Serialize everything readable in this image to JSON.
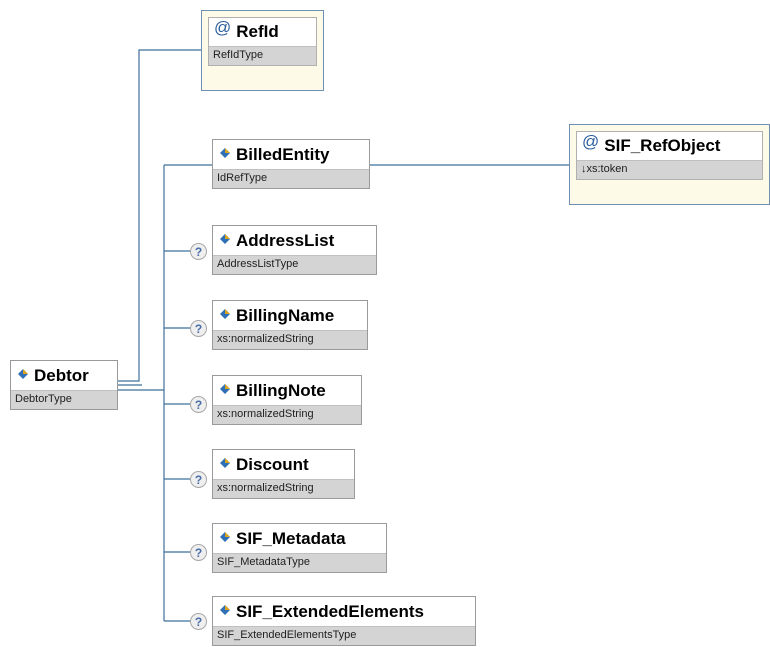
{
  "root": {
    "name": "Debtor",
    "type": "DebtorType"
  },
  "attribute": {
    "name": "RefId",
    "type": "RefIdType",
    "symbol": "@"
  },
  "children": [
    {
      "name": "BilledEntity",
      "type": "IdRefType",
      "optional": false
    },
    {
      "name": "AddressList",
      "type": "AddressListType",
      "optional": true
    },
    {
      "name": "BillingName",
      "type": "xs:normalizedString",
      "optional": true
    },
    {
      "name": "BillingNote",
      "type": "xs:normalizedString",
      "optional": true
    },
    {
      "name": "Discount",
      "type": "xs:normalizedString",
      "optional": true
    },
    {
      "name": "SIF_Metadata",
      "type": "SIF_MetadataType",
      "optional": true
    },
    {
      "name": "SIF_ExtendedElements",
      "type": "SIF_ExtendedElementsType",
      "optional": true
    }
  ],
  "billed_entity_attribute": {
    "name": "SIF_RefObject",
    "type": "↓xs:token",
    "symbol": "@"
  },
  "optional_marker": "?",
  "colors": {
    "connector": "#3f6f99",
    "attribute_border": "#6f8fb3",
    "attribute_fill": "#fdfbe8",
    "type_strip": "#d4d4d4",
    "element_icon_blue": "#2f6fb5",
    "element_icon_gold": "#d9a520"
  },
  "icons": {
    "element": "element-diamond-icon",
    "attribute": "at-sign-icon",
    "optional": "question-mark-icon"
  }
}
